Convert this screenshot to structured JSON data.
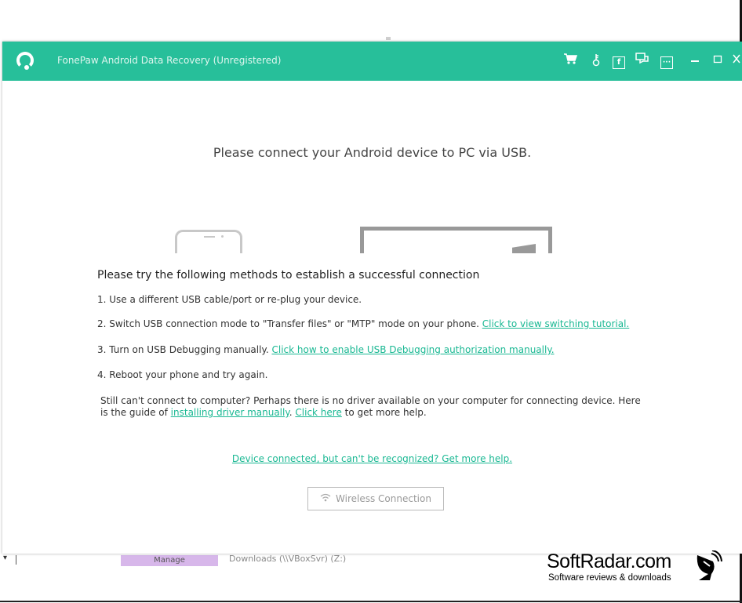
{
  "window": {
    "title": "FonePaw Android Data Recovery (Unregistered)",
    "accent_color": "#27bf9a",
    "toolbar": [
      {
        "name": "cart-icon",
        "glyph": "♉"
      },
      {
        "name": "key-icon",
        "glyph": "⚷"
      },
      {
        "name": "facebook-icon",
        "glyph": "f"
      },
      {
        "name": "feedback-icon",
        "glyph": "✉"
      },
      {
        "name": "menu-icon",
        "glyph": "⋯"
      }
    ]
  },
  "main": {
    "heading": "Please connect your Android device to PC via USB.",
    "help_title": "Please try the following methods to establish a successful connection",
    "steps": [
      {
        "text": "1. Use a different USB cable/port or re-plug your device.",
        "link": ""
      },
      {
        "text": "2. Switch USB connection mode to \"Transfer files\" or \"MTP\" mode on your phone. ",
        "link": "Click to view switching tutorial."
      },
      {
        "text": "3. Turn on USB Debugging manually. ",
        "link": "Click how to enable USB Debugging authorization manually."
      },
      {
        "text": "4. Reboot your phone and try again.",
        "link": ""
      }
    ],
    "note": {
      "part1": "Still can't connect to computer? Perhaps there is no driver available on your computer for connecting device. Here is the guide of ",
      "link1": "installing driver manually",
      "part2": ". ",
      "link2": "Click here",
      "part3": " to get more help."
    },
    "recognize_link": "Device connected, but can't be recognized? Get more help.",
    "wireless_button": "Wireless Connection"
  },
  "background": {
    "manage_label": "Manage",
    "path_text": "Downloads (\\\\VBoxSvr) (Z:)"
  },
  "watermark": {
    "name": "SoftRadar.com",
    "tagline": "Software reviews & downloads"
  }
}
